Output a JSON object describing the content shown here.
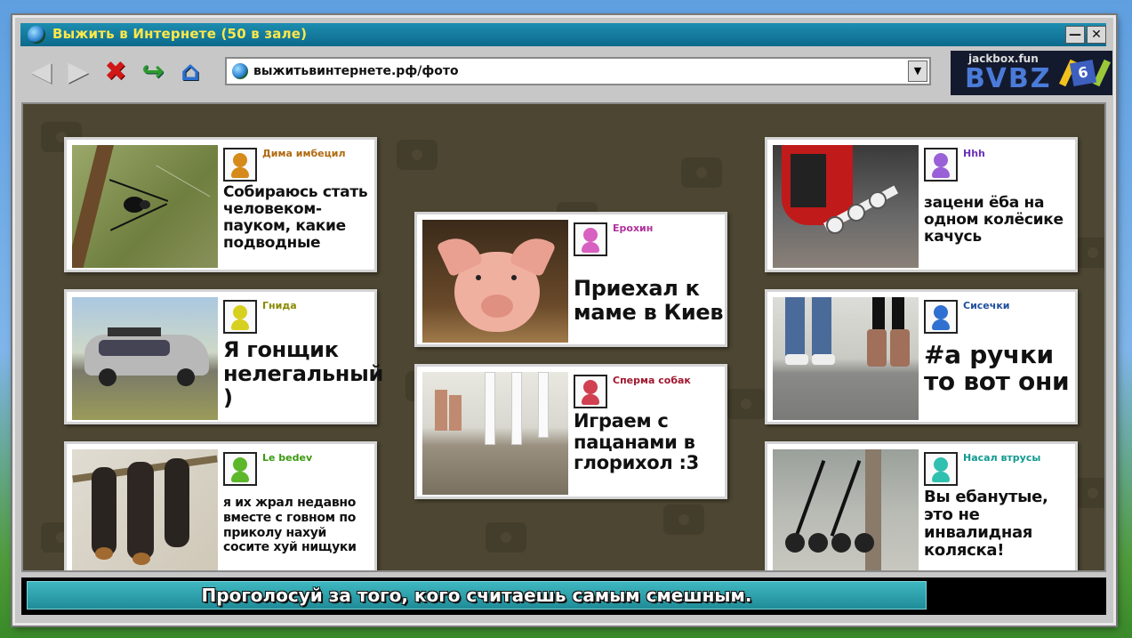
{
  "window": {
    "title": "Выжить в Интернете (50 в зале)",
    "address": "выжитьвинтернете.рф/фото"
  },
  "logo": {
    "top": "jackbox.fun",
    "main": "BVBZ",
    "pack_number": "6"
  },
  "posts": [
    {
      "username": "Дима имбецил",
      "caption": "Собираюсь стать человеком-пауком, какие подводные",
      "user_color": "#b06a10",
      "photo": "spider"
    },
    {
      "username": "Гнида",
      "caption": "Я гонщик нелегальный )",
      "user_color": "#8a8a00",
      "photo": "minivan"
    },
    {
      "username": "Le bedev",
      "caption": "я их жрал недавно вместе с говном по приколу нахуй сосите хуй нищуки",
      "user_color": "#3c9a10",
      "photo": "bats"
    },
    {
      "username": "Ерохин",
      "caption": "Приехал к маме в Киев",
      "user_color": "#b0309a",
      "photo": "pig"
    },
    {
      "username": "Сперма собак",
      "caption": "Играем с пацанами в глорихол :3",
      "user_color": "#a01830",
      "photo": "chairs"
    },
    {
      "username": "Hhh",
      "caption": "зацени ёба на одном колёсике качусь",
      "user_color": "#6a30b8",
      "photo": "rollerskate"
    },
    {
      "username": "Сисечки",
      "caption": "#а ручки то вот они",
      "user_color": "#2050a0",
      "photo": "legs"
    },
    {
      "username": "Насал втрусы",
      "caption": "Вы ебанутые, это не инвалидная коляска!",
      "user_color": "#109a90",
      "photo": "scooter"
    }
  ],
  "prompt": "Проголосуй за того, кого считаешь самым смешным."
}
